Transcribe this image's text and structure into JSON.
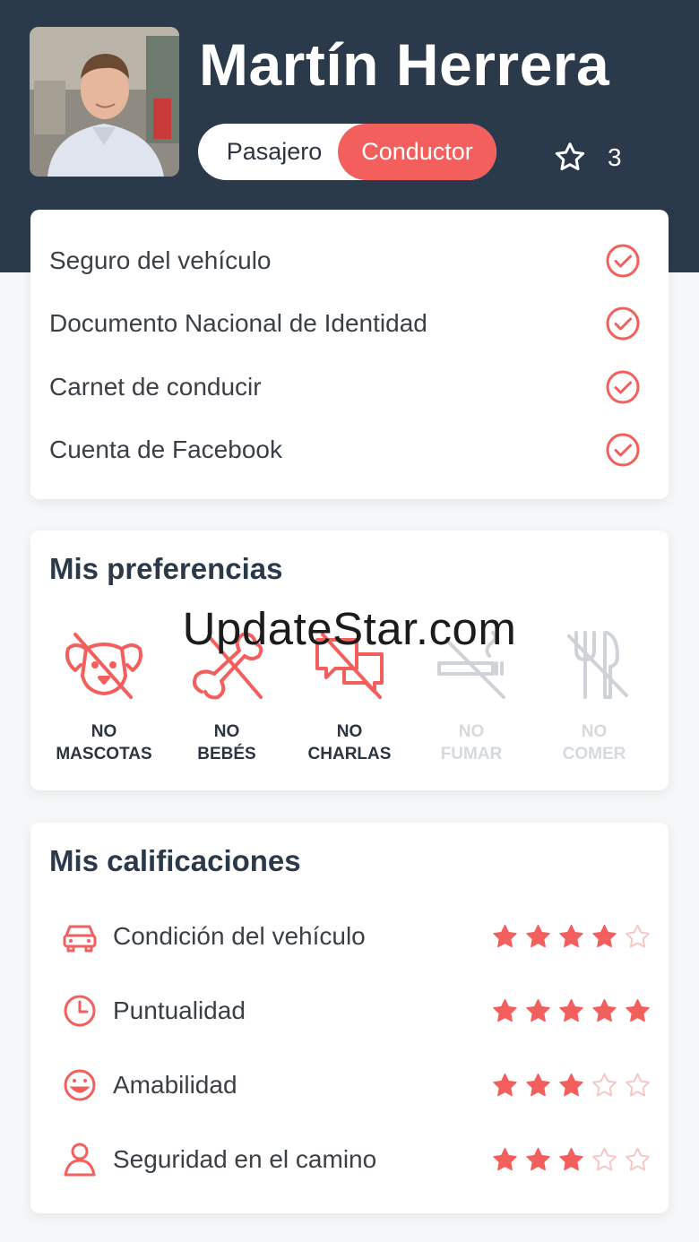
{
  "profile": {
    "name": "Martín Herrera",
    "role_toggle": {
      "left_label": "Pasajero",
      "right_label": "Conductor",
      "selected": "Conductor"
    },
    "rating_count": "3"
  },
  "verifications": [
    {
      "label": "Seguro del vehículo",
      "verified": true
    },
    {
      "label": "Documento Nacional de Identidad",
      "verified": true
    },
    {
      "label": "Carnet de conducir",
      "verified": true
    },
    {
      "label": "Cuenta de Facebook",
      "verified": true
    }
  ],
  "preferences": {
    "title": "Mis preferencias",
    "items": [
      {
        "line1": "NO",
        "line2": "MASCOTAS",
        "icon": "no-pets-icon",
        "active": true
      },
      {
        "line1": "NO",
        "line2": "BEBÉS",
        "icon": "no-babies-icon",
        "active": true
      },
      {
        "line1": "NO",
        "line2": "CHARLAS",
        "icon": "no-chat-icon",
        "active": true
      },
      {
        "line1": "NO",
        "line2": "FUMAR",
        "icon": "no-smoking-icon",
        "active": false
      },
      {
        "line1": "NO",
        "line2": "COMER",
        "icon": "no-eating-icon",
        "active": false
      }
    ]
  },
  "ratings": {
    "title": "Mis calificaciones",
    "items": [
      {
        "label": "Condición del vehículo",
        "icon": "car-icon",
        "stars": 4,
        "max": 5
      },
      {
        "label": "Puntualidad",
        "icon": "clock-icon",
        "stars": 5,
        "max": 5
      },
      {
        "label": "Amabilidad",
        "icon": "smile-icon",
        "stars": 3,
        "max": 5
      },
      {
        "label": "Seguridad en el camino",
        "icon": "person-icon",
        "stars": 3,
        "max": 5
      }
    ]
  },
  "watermark": "UpdateStar.com",
  "colors": {
    "header": "#2a3a4b",
    "accent": "#f25f5c",
    "disabled": "#d6d9dd"
  }
}
